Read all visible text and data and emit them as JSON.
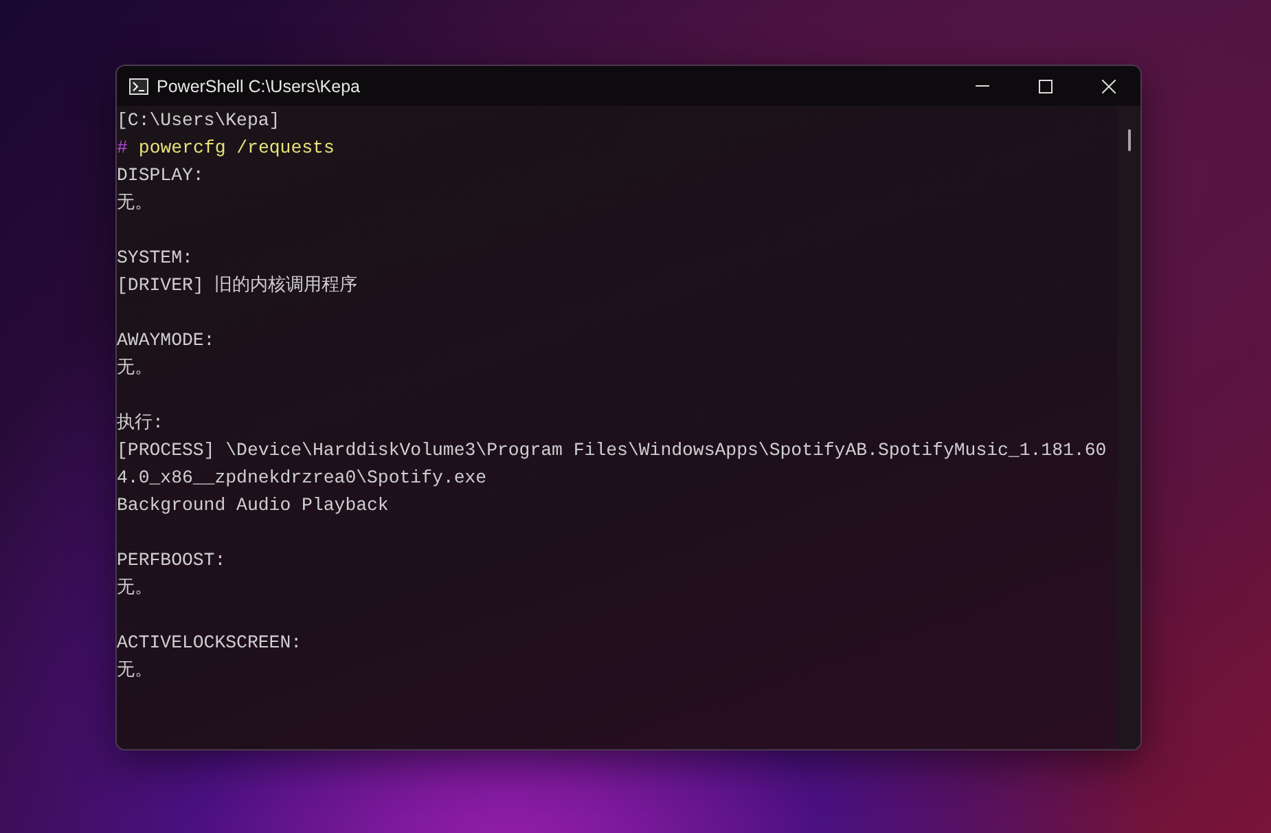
{
  "window": {
    "title": "PowerShell C:\\Users\\Kepa"
  },
  "terminal": {
    "lines": [
      {
        "kind": "output",
        "text": "[C:\\Users\\Kepa]"
      },
      {
        "kind": "command",
        "marker": "#",
        "text": "powercfg /requests"
      },
      {
        "kind": "output",
        "text": "DISPLAY:"
      },
      {
        "kind": "output",
        "text": "无。"
      },
      {
        "kind": "blank"
      },
      {
        "kind": "output",
        "text": "SYSTEM:"
      },
      {
        "kind": "output",
        "text": "[DRIVER] 旧的内核调用程序"
      },
      {
        "kind": "blank"
      },
      {
        "kind": "output",
        "text": "AWAYMODE:"
      },
      {
        "kind": "output",
        "text": "无。"
      },
      {
        "kind": "blank"
      },
      {
        "kind": "output",
        "text": "执行:"
      },
      {
        "kind": "output",
        "text": "[PROCESS] \\Device\\HarddiskVolume3\\Program Files\\WindowsApps\\SpotifyAB.SpotifyMusic_1.181.60"
      },
      {
        "kind": "output",
        "text": "4.0_x86__zpdnekdrzrea0\\Spotify.exe"
      },
      {
        "kind": "output",
        "text": "Background Audio Playback"
      },
      {
        "kind": "blank"
      },
      {
        "kind": "output",
        "text": "PERFBOOST:"
      },
      {
        "kind": "output",
        "text": "无。"
      },
      {
        "kind": "blank"
      },
      {
        "kind": "output",
        "text": "ACTIVELOCKSCREEN:"
      },
      {
        "kind": "output",
        "text": "无。"
      }
    ]
  }
}
